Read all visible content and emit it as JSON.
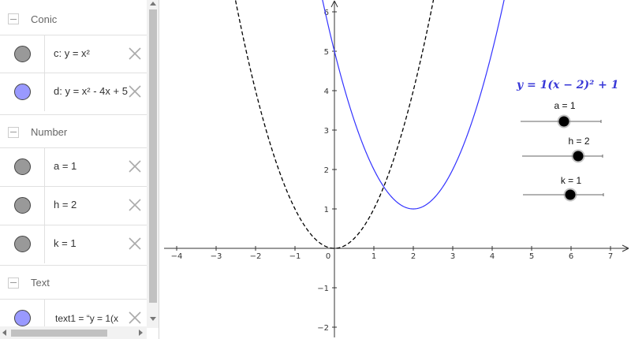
{
  "algebra": {
    "categories": {
      "conic": "Conic",
      "number": "Number",
      "text": "Text"
    },
    "rows": {
      "c": {
        "expr": "c: y = x²",
        "color": "#999999"
      },
      "d": {
        "expr": "d: y = x² - 4x + 5",
        "color": "#9999ff"
      },
      "a": {
        "expr": "a = 1",
        "color": "#999999"
      },
      "h": {
        "expr": "h = 2",
        "color": "#999999"
      },
      "k": {
        "expr": "k = 1",
        "color": "#999999"
      },
      "text1": {
        "expr": "text1 =  “y = 1(x",
        "color": "#9999ff"
      }
    },
    "delete_icon": "close-icon"
  },
  "graphics": {
    "equation": "y = 1(x − 2)² + 1",
    "x_ticks": [
      "−4",
      "−3",
      "−2",
      "−1",
      "0",
      "1",
      "2",
      "3",
      "4",
      "5",
      "6",
      "7"
    ],
    "y_ticks": [
      "6",
      "5",
      "4",
      "3",
      "2",
      "1",
      "−1",
      "−2"
    ],
    "sliders": {
      "a": {
        "label": "a = 1",
        "value": 1
      },
      "h": {
        "label": "h = 2",
        "value": 2
      },
      "k": {
        "label": "k = 1",
        "value": 1
      }
    },
    "colors": {
      "parabola_d": "#3333ff",
      "parabola_c": "#000000",
      "equation": "#3a3ad8"
    }
  }
}
